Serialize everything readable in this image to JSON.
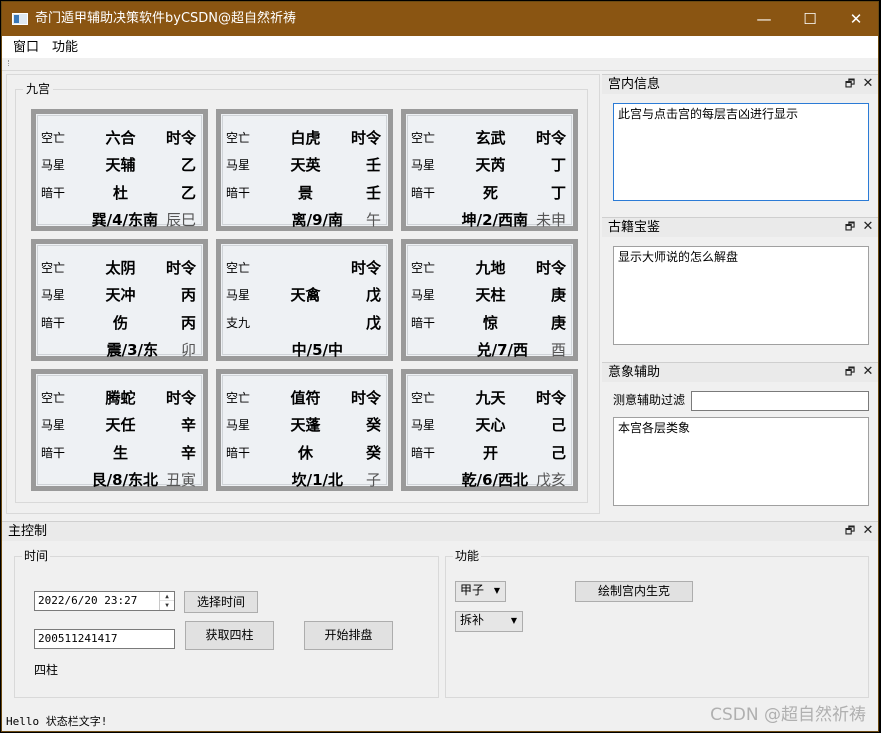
{
  "window": {
    "title": "奇门遁甲辅助决策软件byCSDN@超自然祈祷",
    "minimize": "—",
    "maximize": "☐",
    "close": "✕",
    "title_bar_color": "#8a5512"
  },
  "menu": [
    "窗口",
    "功能"
  ],
  "jiugong": {
    "title": "九宫",
    "palaces": [
      {
        "tl": "空亡",
        "c1": "六合",
        "r1": "时令",
        "ml": "马星",
        "c2": "天辅",
        "r2": "乙",
        "bl": "暗干",
        "c3": "杜",
        "r3": "乙",
        "bottom": "巽/4/东南",
        "br": "辰巳"
      },
      {
        "tl": "空亡",
        "c1": "白虎",
        "r1": "时令",
        "ml": "马星",
        "c2": "天英",
        "r2": "壬",
        "bl": "暗干",
        "c3": "景",
        "r3": "壬",
        "bottom": "离/9/南",
        "br": "午"
      },
      {
        "tl": "空亡",
        "c1": "玄武",
        "r1": "时令",
        "ml": "马星",
        "c2": "天芮",
        "r2": "丁",
        "bl": "暗干",
        "c3": "死",
        "r3": "丁",
        "bottom": "坤/2/西南",
        "br": "未申"
      },
      {
        "tl": "空亡",
        "c1": "太阴",
        "r1": "时令",
        "ml": "马星",
        "c2": "天冲",
        "r2": "丙",
        "bl": "暗干",
        "c3": "伤",
        "r3": "丙",
        "bottom": "震/3/东",
        "br": "卯"
      },
      {
        "tl": "空亡",
        "c1": "",
        "r1": "时令",
        "ml": "马星",
        "c2": "天禽",
        "r2": "戊",
        "bl": "支九",
        "c3": "",
        "r3": "戊",
        "bottom": "中/5/中",
        "br": ""
      },
      {
        "tl": "空亡",
        "c1": "九地",
        "r1": "时令",
        "ml": "马星",
        "c2": "天柱",
        "r2": "庚",
        "bl": "暗干",
        "c3": "惊",
        "r3": "庚",
        "bottom": "兑/7/西",
        "br": "酉"
      },
      {
        "tl": "空亡",
        "c1": "腾蛇",
        "r1": "时令",
        "ml": "马星",
        "c2": "天任",
        "r2": "辛",
        "bl": "暗干",
        "c3": "生",
        "r3": "辛",
        "bottom": "艮/8/东北",
        "br": "丑寅"
      },
      {
        "tl": "空亡",
        "c1": "值符",
        "r1": "时令",
        "ml": "马星",
        "c2": "天蓬",
        "r2": "癸",
        "bl": "暗干",
        "c3": "休",
        "r3": "癸",
        "bottom": "坎/1/北",
        "br": "子"
      },
      {
        "tl": "空亡",
        "c1": "九天",
        "r1": "时令",
        "ml": "马星",
        "c2": "天心",
        "r2": "己",
        "bl": "暗干",
        "c3": "开",
        "r3": "己",
        "bottom": "乾/6/西北",
        "br": "戊亥"
      }
    ]
  },
  "docks": {
    "palace_info": {
      "title": "宫内信息",
      "text": "此宫与点击宫的每层吉凶进行显示"
    },
    "classics": {
      "title": "古籍宝鉴",
      "text": "显示大师说的怎么解盘"
    },
    "imagery": {
      "title": "意象辅助",
      "filter_label": "测意辅助过滤",
      "filter_value": "",
      "text": "本宫各层类象"
    },
    "float_icon": "🗗",
    "close_icon": "✕"
  },
  "main_control": {
    "title": "主控制",
    "time_group": {
      "title": "时间",
      "datetime": "2022/6/20 23:27",
      "select_time": "选择时间",
      "number_value": "200511241417",
      "get_pillars": "获取四柱",
      "start_layout": "开始排盘",
      "pillars_label": "四柱"
    },
    "function_group": {
      "title": "功能",
      "combo1": "甲子",
      "combo2": "拆补",
      "draw_button": "绘制宫内生克"
    }
  },
  "status": "Hello 状态栏文字!",
  "watermark": "CSDN @超自然祈祷"
}
